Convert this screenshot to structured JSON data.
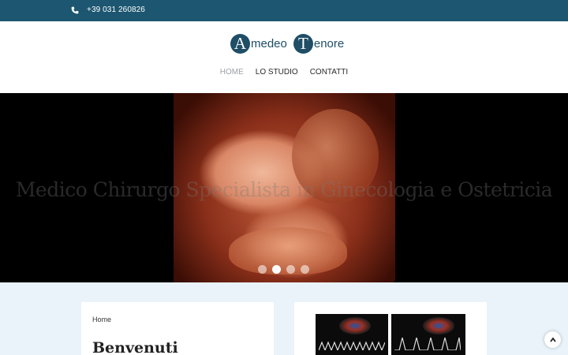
{
  "topbar": {
    "phone": "+39 031 260826",
    "phone_icon": "phone-icon",
    "bg": "#1c5670"
  },
  "logo": {
    "initial1": "A",
    "word1": "medeo",
    "initial2": "T",
    "word2": "enore"
  },
  "nav": {
    "items": [
      {
        "label": "HOME",
        "active": true
      },
      {
        "label": "LO STUDIO"
      },
      {
        "label": "CONTATTI"
      }
    ]
  },
  "hero": {
    "caption": "Medico Chirurgo Specialista in Ginecologia e Ostetricia",
    "slides_total": 4,
    "active_slide": 2
  },
  "left_card": {
    "breadcrumb": "Home",
    "heading": "Benvenuti"
  },
  "right_card": {
    "images": [
      "ultrasound-image",
      "doppler-ultrasound-image"
    ]
  },
  "scroll_top_icon": "chevron-up-icon"
}
